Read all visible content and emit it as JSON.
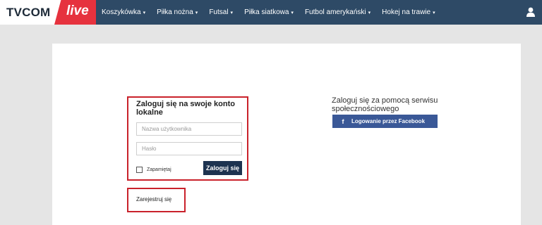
{
  "brand": {
    "name": "TVCOM",
    "live": "live"
  },
  "nav": {
    "items": [
      {
        "label": "Koszykówka"
      },
      {
        "label": "Piłka nożna"
      },
      {
        "label": "Futsal"
      },
      {
        "label": "Piłka siatkowa"
      },
      {
        "label": "Futbol amerykański"
      },
      {
        "label": "Hokej na trawie"
      }
    ],
    "chevron": "▾",
    "user_icon": "user-icon"
  },
  "login": {
    "title": "Zaloguj się na swoje konto lokalne",
    "username_placeholder": "Nazwa użytkownika",
    "password_placeholder": "Hasło",
    "remember_label": "Zapamiętaj",
    "submit_label": "Zaloguj się"
  },
  "register": {
    "label": "Zarejestruj się"
  },
  "social": {
    "title": "Zaloguj się za pomocą serwisu społecznościowego",
    "facebook_label": "Logowanie przez Facebook",
    "facebook_icon": "f"
  },
  "colors": {
    "navbar": "#2e4a66",
    "brand_red": "#e6323e",
    "highlight_border": "#c9222b",
    "button_dark": "#1d3350",
    "facebook": "#3a5897"
  }
}
